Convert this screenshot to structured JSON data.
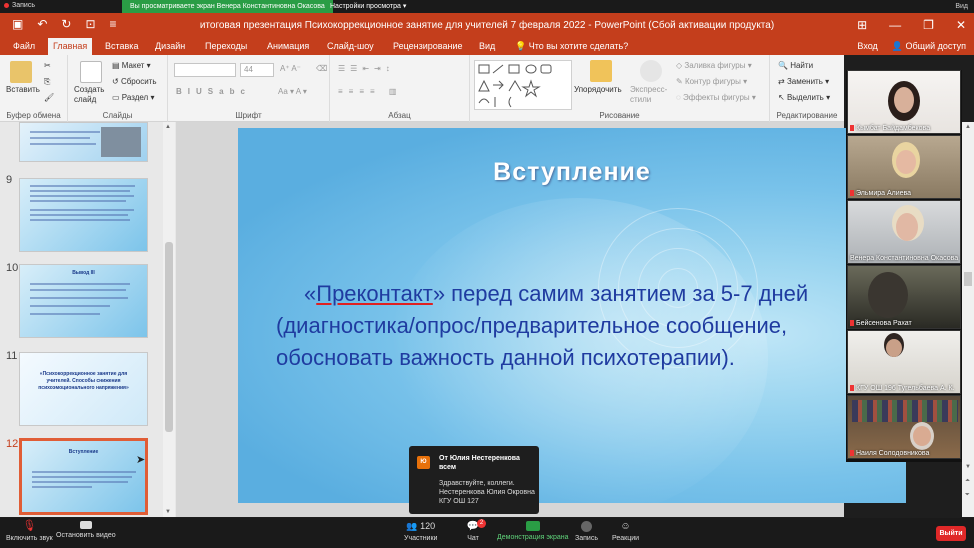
{
  "zoom_top": {
    "record_label": "Запись",
    "viewing_banner": "Вы просматриваете экран Венера Константиновна Окасова",
    "view_options": "Настройки просмотра",
    "view_label": "Вид"
  },
  "window": {
    "title": "итоговая презентация Психокоррекционное занятие для учителей 7 февраля 2022 - PowerPoint (Сбой активации продукта)"
  },
  "tabs": {
    "file": "Файл",
    "home": "Главная",
    "insert": "Вставка",
    "design": "Дизайн",
    "transitions": "Переходы",
    "animation": "Анимация",
    "slideshow": "Слайд-шоу",
    "review": "Рецензирование",
    "view": "Вид",
    "tellme": "Что вы хотите сделать?",
    "signin": "Вход",
    "share": "Общий доступ"
  },
  "ribbon": {
    "paste": "Вставить",
    "clipboard": "Буфер обмена",
    "new_slide": "Создать слайд",
    "layout": "Макет",
    "reset": "Сбросить",
    "section": "Раздел",
    "slides": "Слайды",
    "font_size": "44",
    "font": "Шрифт",
    "paragraph": "Абзац",
    "arrange": "Упорядочить",
    "quick_styles": "Экспресс-стили",
    "shape_fill": "Заливка фигуры",
    "shape_outline": "Контур фигуры",
    "shape_effects": "Эффекты фигуры",
    "drawing": "Рисование",
    "find": "Найти",
    "replace": "Заменить",
    "select": "Выделить",
    "editing": "Редактирование"
  },
  "thumbnails": [
    {
      "num": "9",
      "title": ""
    },
    {
      "num": "10",
      "title": "Вывод III"
    },
    {
      "num": "11",
      "title": "«Психокоррекционное занятие для учителей. Способы снижения психоэмоционального напряжения»"
    },
    {
      "num": "12",
      "title": "Вступление"
    }
  ],
  "slide": {
    "title": "Вступление",
    "body_underlined": "Преконтакт",
    "body_pre": "«",
    "body_post": "» перед самим занятием за 5-7 дней (диагностика/опрос/предварительное сообщение, обосновать важность данной психотерапии)."
  },
  "participants": [
    "Кымбат Байдамбекова",
    "Эльмира Алиева",
    "Венера Константиновна Окасова",
    "Бейсенова Рахат",
    "КГУ ОШ 196 Тугельбаева А. К.",
    "Наиля Солодовникова"
  ],
  "chat_popup": {
    "avatar": "Ю",
    "from_line1": "От Юлия Нестеренкова",
    "from_line2": "всем",
    "msg_line1": "Здравствуйте, коллеги.",
    "msg_line2": "Нестеренкова Юлия Окровна",
    "msg_line3": "КГУ ОШ 127"
  },
  "zoom_bottom": {
    "unmute": "Включить звук",
    "stop_video": "Остановить видео",
    "participants": "Участники",
    "participants_count": "120",
    "chat": "Чат",
    "chat_badge": "2",
    "share": "Демонстрация экрана",
    "record": "Запись",
    "reactions": "Реакции",
    "leave": "Выйти"
  },
  "colors": {
    "ppt_accent": "#c43e1c",
    "zoom_green": "#2a9d45",
    "slide_text": "#1f3ba0"
  }
}
